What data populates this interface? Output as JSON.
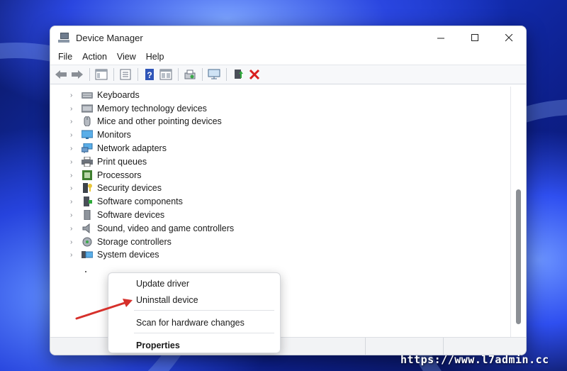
{
  "window": {
    "title": "Device Manager",
    "controls": {
      "minimize": "—",
      "maximize": "☐",
      "close": "✕"
    }
  },
  "menu": [
    "File",
    "Action",
    "View",
    "Help"
  ],
  "toolbar_icons": [
    "back-arrow-icon",
    "forward-arrow-icon",
    "show-hide-icon",
    "properties-icon",
    "help-icon",
    "view-icon",
    "scan-hardware-icon",
    "monitor-icon",
    "update-driver-icon",
    "uninstall-icon"
  ],
  "tree": [
    {
      "label": "Keyboards",
      "icon": "keyboard-icon"
    },
    {
      "label": "Memory technology devices",
      "icon": "memory-icon"
    },
    {
      "label": "Mice and other pointing devices",
      "icon": "mouse-icon"
    },
    {
      "label": "Monitors",
      "icon": "monitor-icon"
    },
    {
      "label": "Network adapters",
      "icon": "network-icon"
    },
    {
      "label": "Print queues",
      "icon": "printer-icon"
    },
    {
      "label": "Processors",
      "icon": "processor-icon"
    },
    {
      "label": "Security devices",
      "icon": "security-icon"
    },
    {
      "label": "Software components",
      "icon": "software-component-icon"
    },
    {
      "label": "Software devices",
      "icon": "software-device-icon"
    },
    {
      "label": "Sound, video and game controllers",
      "icon": "speaker-icon"
    },
    {
      "label": "Storage controllers",
      "icon": "storage-icon"
    },
    {
      "label": "System devices",
      "icon": "system-icon"
    }
  ],
  "context_menu": {
    "update": "Update driver",
    "uninstall": "Uninstall device",
    "scan": "Scan for hardware changes",
    "properties": "Properties"
  },
  "watermark": "https://www.l7admin.cc",
  "colors": {
    "annotation_arrow": "#d6302b",
    "uninstall_x": "#d81e1e"
  }
}
